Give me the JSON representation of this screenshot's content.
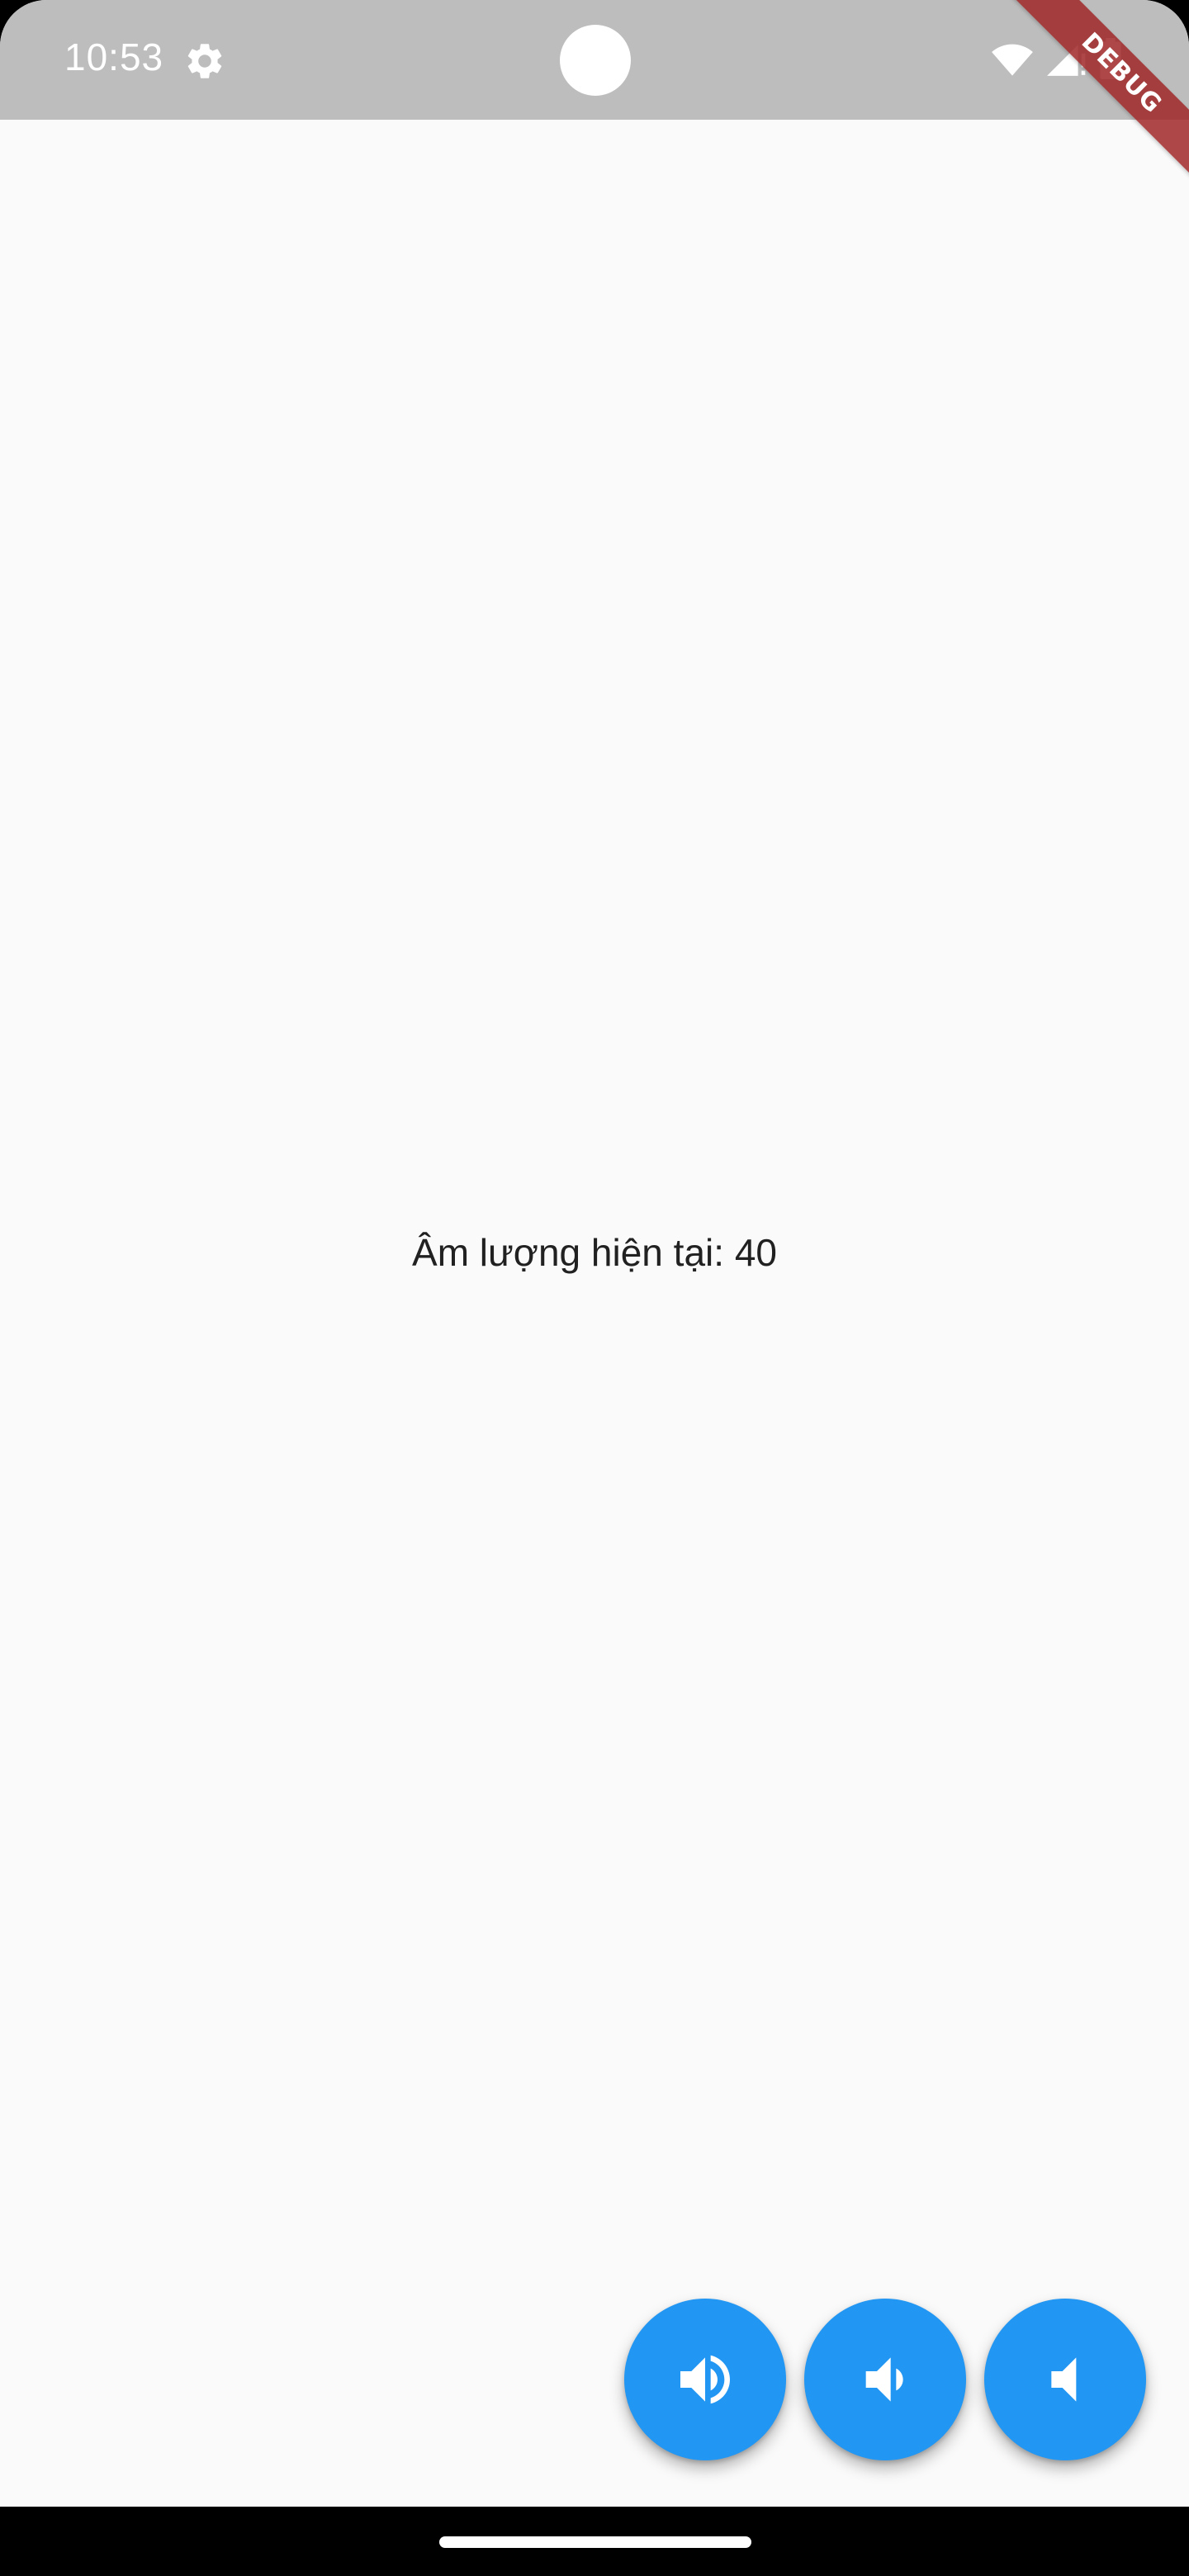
{
  "status_bar": {
    "time": "10:53",
    "icons": [
      "settings-gear-icon",
      "wifi-icon",
      "cell-signal-icon",
      "battery-icon"
    ],
    "color": "#bdbdbd"
  },
  "debug_banner": {
    "label": "DEBUG"
  },
  "main": {
    "volume_text": "Âm lượng hiện tại: 40",
    "background": "#fafafa"
  },
  "actions": [
    {
      "name": "volume-up-button",
      "icon": "volume-up-icon"
    },
    {
      "name": "volume-down-button",
      "icon": "volume-down-icon"
    },
    {
      "name": "volume-mute-button",
      "icon": "volume-mute-icon"
    }
  ],
  "colors": {
    "accent": "#2196f3",
    "text": "#212121",
    "debug_ribbon": "#a02828"
  }
}
